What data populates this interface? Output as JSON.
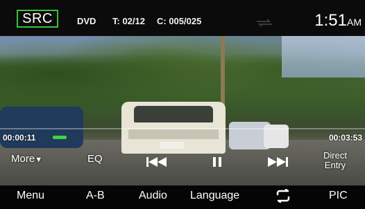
{
  "topbar": {
    "source_button": "SRC",
    "media_type": "DVD",
    "title_info": "T: 02/12",
    "chapter_info": "C: 005/025",
    "clock_time": "1:51",
    "clock_ampm": "AM"
  },
  "progress": {
    "elapsed": "00:00:11",
    "total": "00:03:53",
    "accent_color": "#3fd23f"
  },
  "controls": {
    "more_label": "More",
    "eq_label": "EQ",
    "prev_icon": "skip-previous-icon",
    "pause_icon": "pause-icon",
    "next_icon": "skip-next-icon",
    "direct_entry_line1": "Direct",
    "direct_entry_line2": "Entry"
  },
  "bottom_menu": {
    "menu_label": "Menu",
    "ab_label": "A-B",
    "audio_label": "Audio",
    "language_label": "Language",
    "repeat_icon": "repeat-icon",
    "pic_label": "PIC"
  }
}
